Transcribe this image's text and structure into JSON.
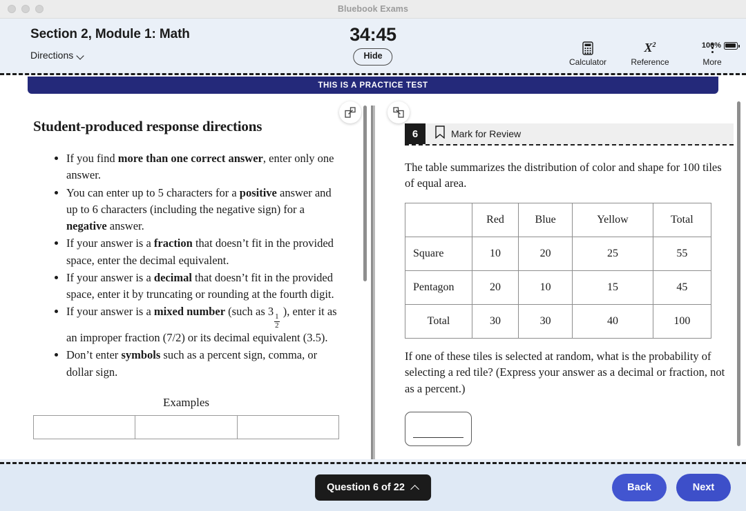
{
  "window": {
    "title": "Bluebook Exams",
    "traffic_lights": [
      "close",
      "minimize",
      "maximize"
    ]
  },
  "header": {
    "section_title": "Section 2, Module 1: Math",
    "directions_label": "Directions",
    "timer": "34:45",
    "hide_label": "Hide",
    "battery_percent": "100%",
    "tools": [
      {
        "label": "Calculator",
        "icon": "calculator-icon"
      },
      {
        "label": "Reference",
        "icon": "x-squared-icon"
      },
      {
        "label": "More",
        "icon": "more-vertical-icon"
      }
    ]
  },
  "banner": {
    "text": "THIS IS A PRACTICE TEST",
    "color": "#24297a"
  },
  "left_pane": {
    "title": "Student-produced response directions",
    "bullets": [
      {
        "before": "If you find ",
        "bold": "more than one correct answer",
        "after": ", enter only one answer."
      },
      {
        "before": "You can enter up to 5 characters for a ",
        "bold": "positive",
        "after": " answer and up to 6 characters (including the negative sign) for a ",
        "bold2": "negative",
        "after2": " answer."
      },
      {
        "before": "If your answer is a ",
        "bold": "fraction",
        "after": " that doesn’t fit in the provided space, enter the decimal equivalent."
      },
      {
        "before": "If your answer is a ",
        "bold": "decimal",
        "after": " that doesn’t fit in the provided space, enter it by truncating or rounding at the fourth digit."
      },
      {
        "before": "If your answer is a ",
        "bold": "mixed number",
        "after_mixed_pre": " (such as 3",
        "frac_num": "1",
        "frac_den": "2",
        "after_mixed_post": " ), enter it as an improper fraction (7/2) or its decimal equivalent (3.5)."
      },
      {
        "before": "Don’t enter ",
        "bold": "symbols",
        "after": " such as a percent sign, comma, or dollar sign."
      }
    ],
    "examples_heading": "Examples"
  },
  "right_pane": {
    "question_number": "6",
    "mark_for_review_label": "Mark for Review",
    "intro_text": "The table summarizes the distribution of color and shape for 100 tiles of equal area.",
    "prompt_text": "If one of these tiles is selected at random, what is the probability of selecting a red tile? (Express your answer as a decimal or fraction, not as a percent.)",
    "answer_value": "",
    "table": {
      "corner": "",
      "columns": [
        "Red",
        "Blue",
        "Yellow",
        "Total"
      ],
      "rows": [
        {
          "label": "Square",
          "align": "left",
          "values": [
            "10",
            "20",
            "25",
            "55"
          ]
        },
        {
          "label": "Pentagon",
          "align": "left",
          "values": [
            "20",
            "10",
            "15",
            "45"
          ]
        },
        {
          "label": "Total",
          "align": "center",
          "values": [
            "30",
            "30",
            "40",
            "100"
          ]
        }
      ]
    }
  },
  "footer": {
    "question_pill": "Question 6 of 22",
    "back_label": "Back",
    "next_label": "Next",
    "button_color": "#4255d0"
  }
}
